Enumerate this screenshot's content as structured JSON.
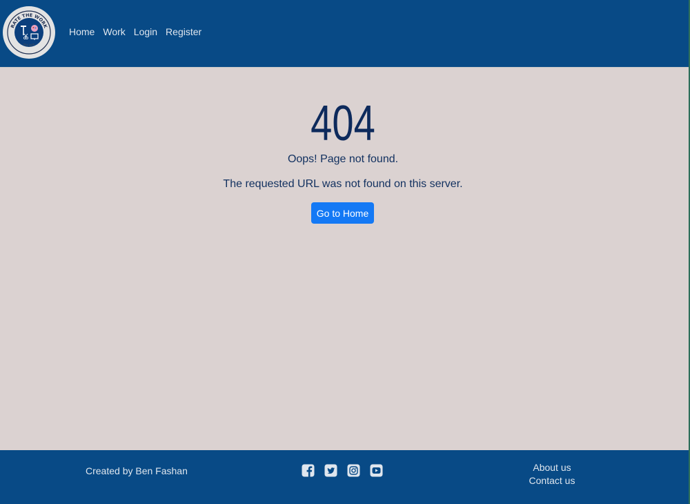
{
  "header": {
    "logo_text": "RATE THE WORK",
    "logo_sub": "EST. 2024",
    "nav": [
      "Home",
      "Work",
      "Login",
      "Register"
    ]
  },
  "main": {
    "code": "404",
    "title": "Oops! Page not found.",
    "message": "The requested URL was not found on this server.",
    "button": "Go to Home"
  },
  "footer": {
    "credit": "Created by Ben Fashan",
    "social_icons": [
      "facebook-icon",
      "twitter-icon",
      "instagram-icon",
      "youtube-icon"
    ],
    "links": [
      "About us",
      "Contact us"
    ]
  },
  "colors": {
    "header_bg": "#084a86",
    "page_bg": "#dbd2d1",
    "button_bg": "#1479f5",
    "heading": "#0d2a5c"
  }
}
